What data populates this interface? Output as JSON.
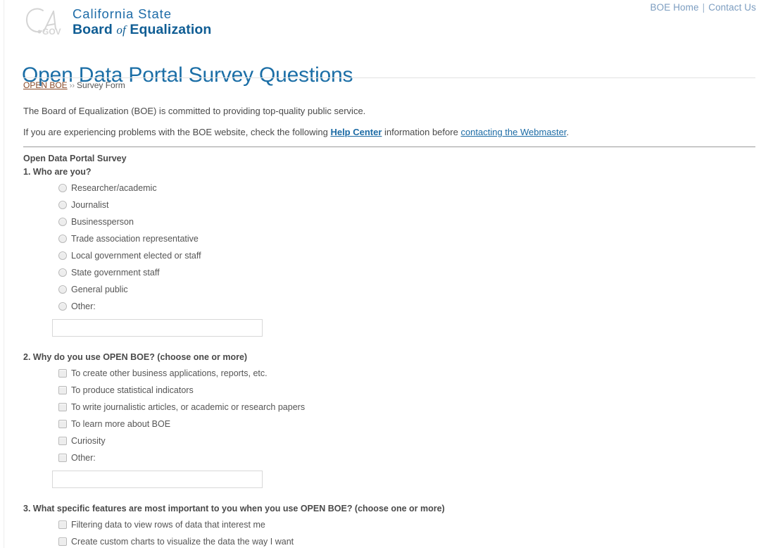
{
  "topnav": {
    "home_label": "BOE Home",
    "separator": "|",
    "contact_label": "Contact Us"
  },
  "brand": {
    "logo_icon": "ca-gov-logo",
    "logo_text": ".GOV",
    "line1": "California State",
    "line2_part1": "Board",
    "line2_of": "of",
    "line2_part2": "Equalization"
  },
  "page_title": "Open Data Portal Survey Questions",
  "breadcrumb": {
    "root_label": "OPEN BOE",
    "arrows": "››",
    "current_label": "Survey Form"
  },
  "intro": {
    "paragraph1": "The Board of Equalization (BOE) is committed to providing top-quality public service.",
    "p2_before": "If you are experiencing problems with the BOE website, check the following ",
    "p2_link1": "Help Center",
    "p2_middle": " information before ",
    "p2_link2": "contacting the Webmaster",
    "p2_after": "."
  },
  "survey": {
    "title": "Open Data Portal Survey",
    "questions": [
      {
        "number": "1.",
        "text": "1. Who are you?",
        "input_type": "radio",
        "options": [
          "Researcher/academic",
          "Journalist",
          "Businessperson",
          "Trade association representative",
          "Local government elected or staff",
          "State government staff",
          "General public",
          "Other:"
        ],
        "other_value": "",
        "other_placeholder": ""
      },
      {
        "number": "2.",
        "text": "2. Why do you use OPEN BOE? (choose one or more)",
        "input_type": "checkbox",
        "options": [
          "To create other business applications, reports, etc.",
          "To produce statistical indicators",
          "To write journalistic articles, or academic or research papers",
          "To learn more about BOE",
          "Curiosity",
          "Other:"
        ],
        "other_value": "",
        "other_placeholder": ""
      },
      {
        "number": "3.",
        "text": "3. What specific features are most important to you when you use OPEN BOE? (choose one or more)",
        "input_type": "checkbox",
        "options": [
          "Filtering data to view rows of data that interest me",
          "Create custom charts to visualize the data the way I want"
        ]
      }
    ]
  },
  "colors": {
    "brand_blue": "#0f5d94",
    "title_blue": "#1b6ea6",
    "link_blue": "#1c6ba5",
    "crumb_brown": "#8a4b2a",
    "topnav_blue": "#7c9dc0",
    "body_gray": "#4a4a4a"
  }
}
